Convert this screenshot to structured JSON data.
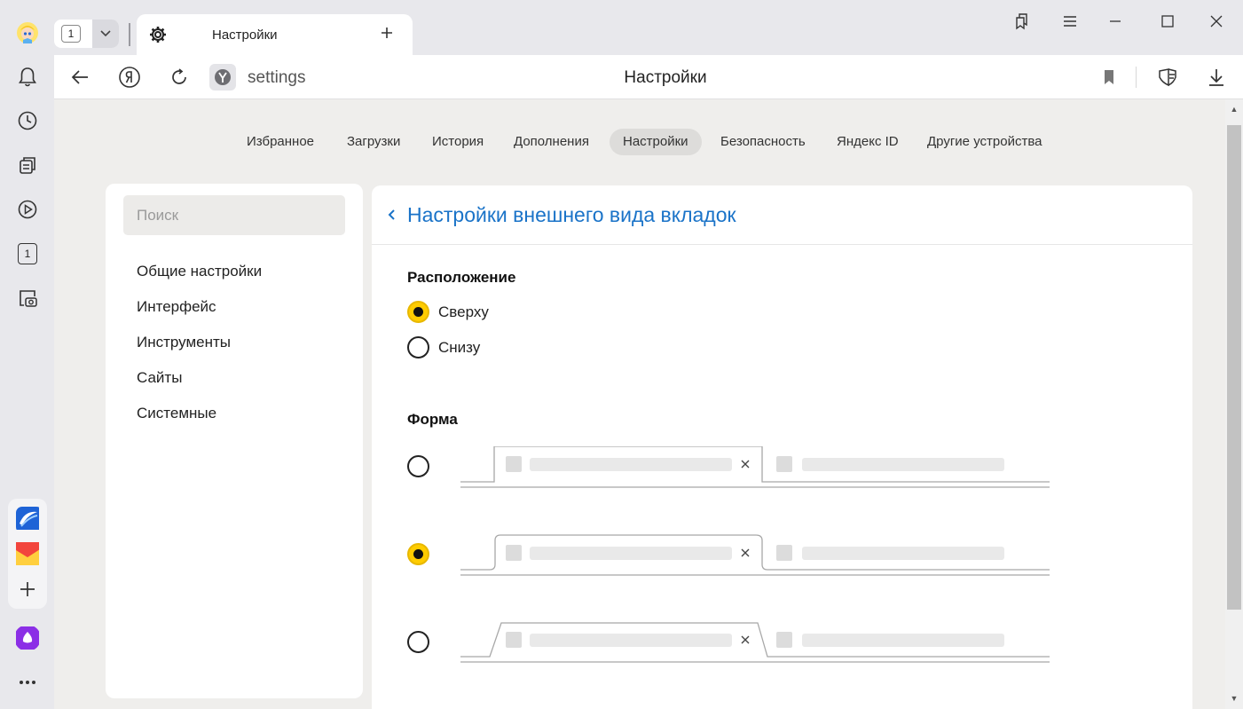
{
  "titlebar": {
    "tab_counter": "1",
    "active_tab_title": "Настройки",
    "active_tab_icon": "gear-icon"
  },
  "addressbar": {
    "url": "settings",
    "page_title": "Настройки"
  },
  "sidebar_counter": "1",
  "nav": {
    "tabs": [
      "Избранное",
      "Загрузки",
      "История",
      "Дополнения",
      "Настройки",
      "Безопасность",
      "Яндекс ID",
      "Другие устройства"
    ],
    "active_index": 4
  },
  "left_menu": {
    "search_placeholder": "Поиск",
    "items": [
      "Общие настройки",
      "Интерфейс",
      "Инструменты",
      "Сайты",
      "Системные"
    ]
  },
  "main": {
    "title": "Настройки внешнего вида вкладок",
    "position_section": {
      "heading": "Расположение",
      "options": [
        "Сверху",
        "Снизу"
      ],
      "selected_index": 0
    },
    "shape_section": {
      "heading": "Форма",
      "selected_index": 1
    }
  },
  "colors": {
    "accent_blue": "#1a73c8",
    "radio_selected": "#ffcc00",
    "content_bg": "#efeeec"
  }
}
